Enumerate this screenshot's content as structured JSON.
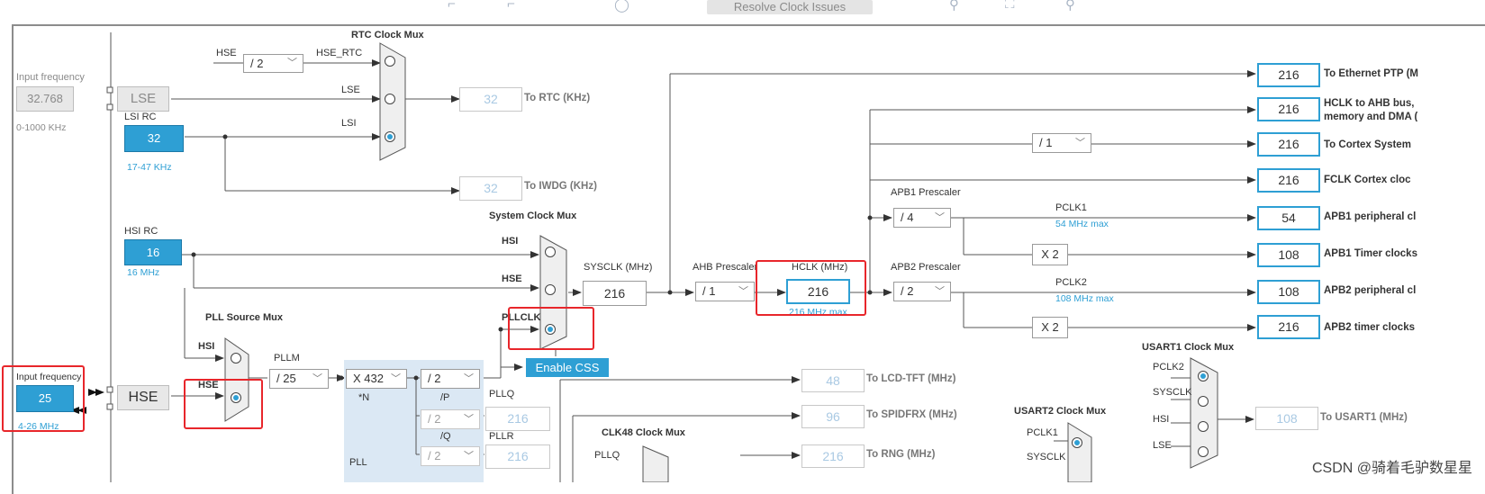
{
  "toolbar": {
    "resolve_label": "Resolve Clock Issues"
  },
  "left": {
    "input_freq_label": "Input frequency",
    "lse_input_value": "32.768",
    "lse_range": "0-1000 KHz",
    "lse_label": "LSE",
    "lsi_rc_label": "LSI RC",
    "lsi_value": "32",
    "lsi_range": "17-47 KHz",
    "hsi_rc_label": "HSI RC",
    "hsi_value": "16",
    "hsi_range": "16 MHz",
    "hse_input_label": "Input frequency",
    "hse_input_value": "25",
    "hse_range": "4-26 MHz",
    "hse_label": "HSE"
  },
  "rtc": {
    "title": "RTC Clock Mux",
    "hse_label": "HSE",
    "div": "/ 2",
    "hse_rtc_label": "HSE_RTC",
    "lse_label": "LSE",
    "lsi_label": "LSI",
    "rtc_value": "32",
    "rtc_dest": "To RTC (KHz)",
    "iwdg_value": "32",
    "iwdg_dest": "To IWDG (KHz)"
  },
  "pll": {
    "source_mux_label": "PLL Source Mux",
    "hsi_label": "HSI",
    "hse_label": "HSE",
    "pllm_label": "PLLM",
    "pllm_value": "/ 25",
    "n_value": "X 432",
    "n_label": "*N",
    "p_value": "/ 2",
    "p_label": "/P",
    "q_value": "/ 2",
    "q_label": "/Q",
    "r_value": "/ 2",
    "pllq_label": "PLLQ",
    "pllq_value": "216",
    "pllr_label": "PLLR",
    "pllr_value": "216",
    "pll_label": "PLL"
  },
  "sysclk": {
    "mux_label": "System Clock Mux",
    "hsi_label": "HSI",
    "hse_label": "HSE",
    "pllclk_label": "PLLCLK",
    "sysclk_label": "SYSCLK (MHz)",
    "sysclk_value": "216",
    "enable_css_label": "Enable CSS",
    "ahb_prescaler_label": "AHB Prescaler",
    "ahb_value": "/ 1",
    "hclk_label": "HCLK (MHz)",
    "hclk_value": "216",
    "hclk_max": "216 MHz max"
  },
  "apb": {
    "apb1_label": "APB1 Prescaler",
    "apb1_value": "/ 4",
    "pclk1_label": "PCLK1",
    "pclk1_max": "54 MHz max",
    "apb1_x2": "X 2",
    "apb2_label": "APB2 Prescaler",
    "apb2_value": "/ 2",
    "pclk2_label": "PCLK2",
    "pclk2_max": "108 MHz max",
    "apb2_x2": "X 2",
    "cortex_div": "/ 1"
  },
  "outputs": [
    {
      "value": "216",
      "label": "To Ethernet PTP (M"
    },
    {
      "value": "216",
      "label": "HCLK to AHB bus,",
      "label2": "memory and DMA ("
    },
    {
      "value": "216",
      "label": "To Cortex System"
    },
    {
      "value": "216",
      "label": "FCLK Cortex cloc"
    },
    {
      "value": "54",
      "label": "APB1 peripheral cl"
    },
    {
      "value": "108",
      "label": "APB1 Timer clocks"
    },
    {
      "value": "108",
      "label": "APB2 peripheral cl"
    },
    {
      "value": "216",
      "label": "APB2 timer clocks"
    }
  ],
  "lower": {
    "lcd_value": "48",
    "lcd_dest": "To LCD-TFT (MHz)",
    "spdif_value": "96",
    "spdif_dest": "To SPIDFRX (MHz)",
    "rng_value": "216",
    "rng_dest": "To RNG (MHz)",
    "clk48_label": "CLK48 Clock Mux",
    "clk48_pllq": "PLLQ",
    "usart1_mux_label": "USART1 Clock Mux",
    "usart1_pclk2": "PCLK2",
    "usart1_sysclk": "SYSCLK",
    "usart1_hsi": "HSI",
    "usart1_lse": "LSE",
    "usart1_value": "108",
    "usart1_dest": "To USART1 (MHz)",
    "usart2_mux_label": "USART2 Clock Mux",
    "usart2_pclk1": "PCLK1",
    "usart2_sysclk": "SYSCLK"
  },
  "watermark": "CSDN @骑着毛驴数星星",
  "colors": {
    "accent": "#2e9fd4",
    "highlight": "#e8262b",
    "wire": "#555555"
  }
}
